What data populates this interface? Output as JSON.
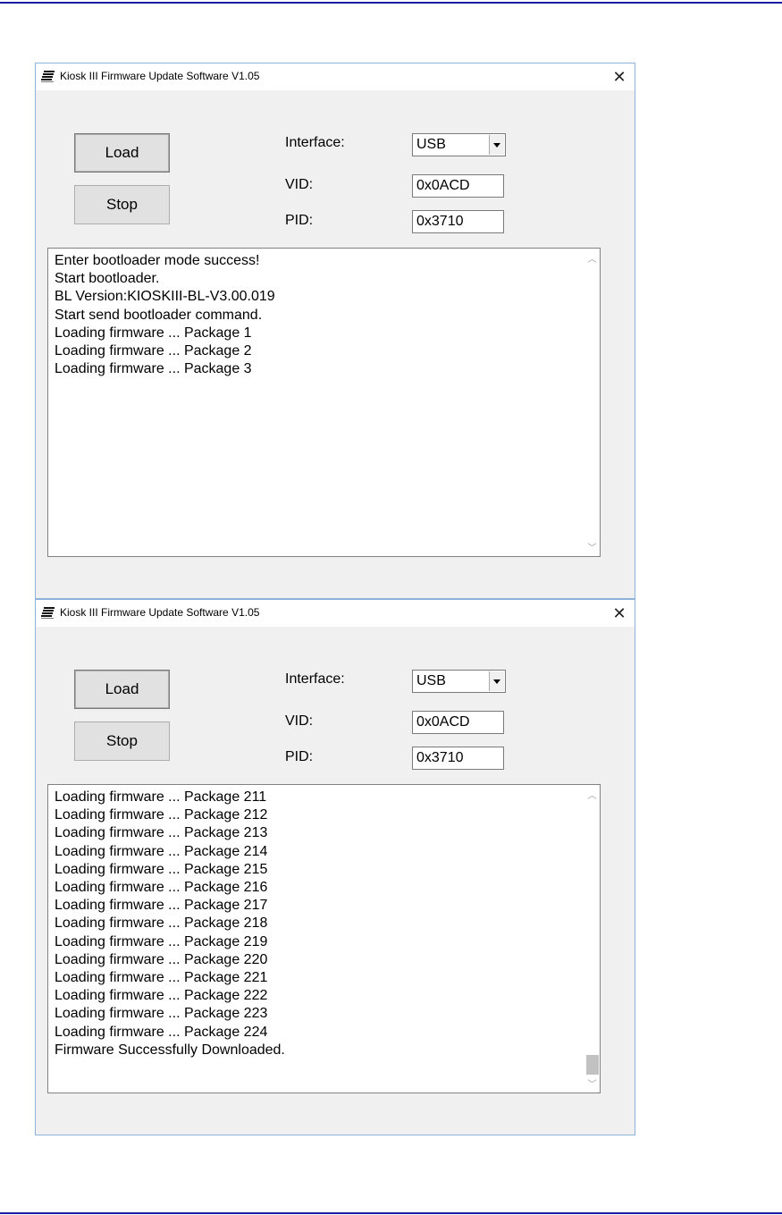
{
  "windows": [
    {
      "title": "Kiosk III Firmware Update Software V1.05",
      "close_glyph": "✕",
      "buttons": {
        "load": "Load",
        "stop": "Stop"
      },
      "labels": {
        "interface": "Interface:",
        "vid": "VID:",
        "pid": "PID:"
      },
      "interface_value": "USB",
      "vid_value": "0x0ACD",
      "pid_value": "0x3710",
      "log": [
        "Enter bootloader mode success!",
        "Start bootloader.",
        "BL Version:KIOSKIII-BL-V3.00.019",
        "Start send bootloader command.",
        "Loading firmware ... Package 1",
        "Loading firmware ... Package 2",
        "Loading firmware ... Package 3"
      ],
      "scroll_up": "︿",
      "scroll_down": "﹀"
    },
    {
      "title": "Kiosk III Firmware Update Software V1.05",
      "close_glyph": "✕",
      "buttons": {
        "load": "Load",
        "stop": "Stop"
      },
      "labels": {
        "interface": "Interface:",
        "vid": "VID:",
        "pid": "PID:"
      },
      "interface_value": "USB",
      "vid_value": "0x0ACD",
      "pid_value": "0x3710",
      "log": [
        "Loading firmware ... Package 211",
        "Loading firmware ... Package 212",
        "Loading firmware ... Package 213",
        "Loading firmware ... Package 214",
        "Loading firmware ... Package 215",
        "Loading firmware ... Package 216",
        "Loading firmware ... Package 217",
        "Loading firmware ... Package 218",
        "Loading firmware ... Package 219",
        "Loading firmware ... Package 220",
        "Loading firmware ... Package 221",
        "Loading firmware ... Package 222",
        "Loading firmware ... Package 223",
        "Loading firmware ... Package 224",
        "Firmware Successfully Downloaded."
      ],
      "scroll_up": "︿",
      "scroll_down": "﹀"
    }
  ],
  "colors": {
    "rule": "#1c1ca0",
    "window_border": "#8fb3d6",
    "window_bg": "#f0f0f0"
  },
  "icons": {
    "app": "app-logo-icon",
    "close": "close-icon"
  }
}
